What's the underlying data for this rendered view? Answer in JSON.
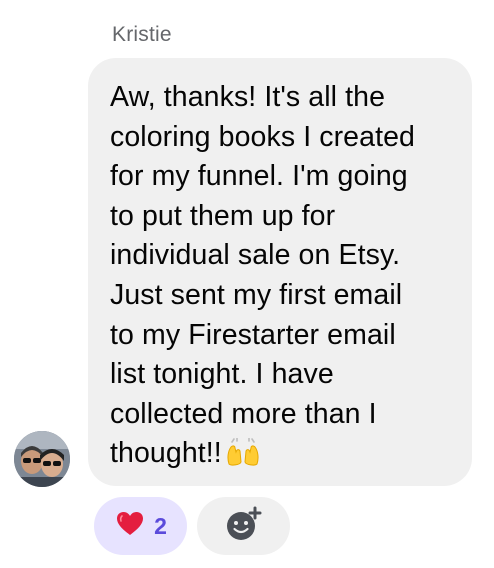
{
  "message": {
    "sender": "Kristie",
    "lines": [
      "Aw, thanks! It's all the",
      "coloring books I created",
      "for my funnel. I'm going",
      "to put them up for",
      "individual sale on Etsy.",
      "Just sent my first email",
      "to my Firestarter email",
      "list tonight. I have",
      "collected more than I",
      "thought!!"
    ],
    "trailing_emoji": "raising-hands-emoji"
  },
  "reactions": {
    "heart_count": "2",
    "heart_icon": "heart-icon",
    "add_icon": "add-reaction-icon"
  },
  "colors": {
    "bubble": "#f0f0f0",
    "reaction_bg": "#e7e3ff",
    "reaction_count": "#5b4bdb",
    "heart": "#e41e3f",
    "sender": "#65676b"
  }
}
